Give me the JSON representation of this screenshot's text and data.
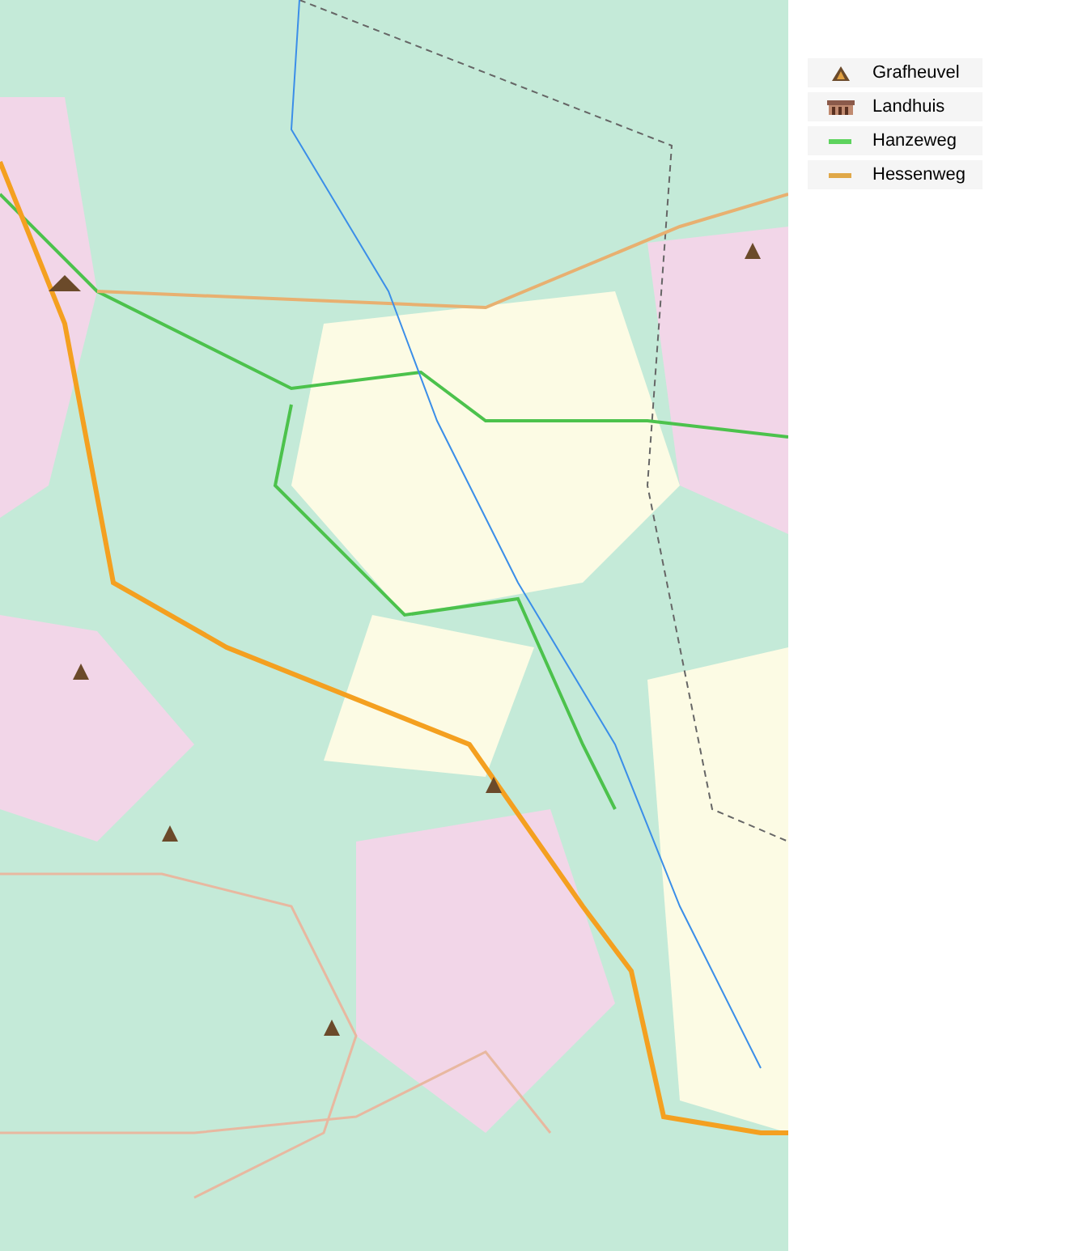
{
  "legend": {
    "items": [
      {
        "kind": "mound",
        "label": "Grafheuvel"
      },
      {
        "kind": "building",
        "label": "Landhuis"
      },
      {
        "kind": "line",
        "label": "Hanzeweg",
        "color": "#5dd35d"
      },
      {
        "kind": "line",
        "label": "Hessenweg",
        "color": "#e0a848"
      }
    ]
  }
}
